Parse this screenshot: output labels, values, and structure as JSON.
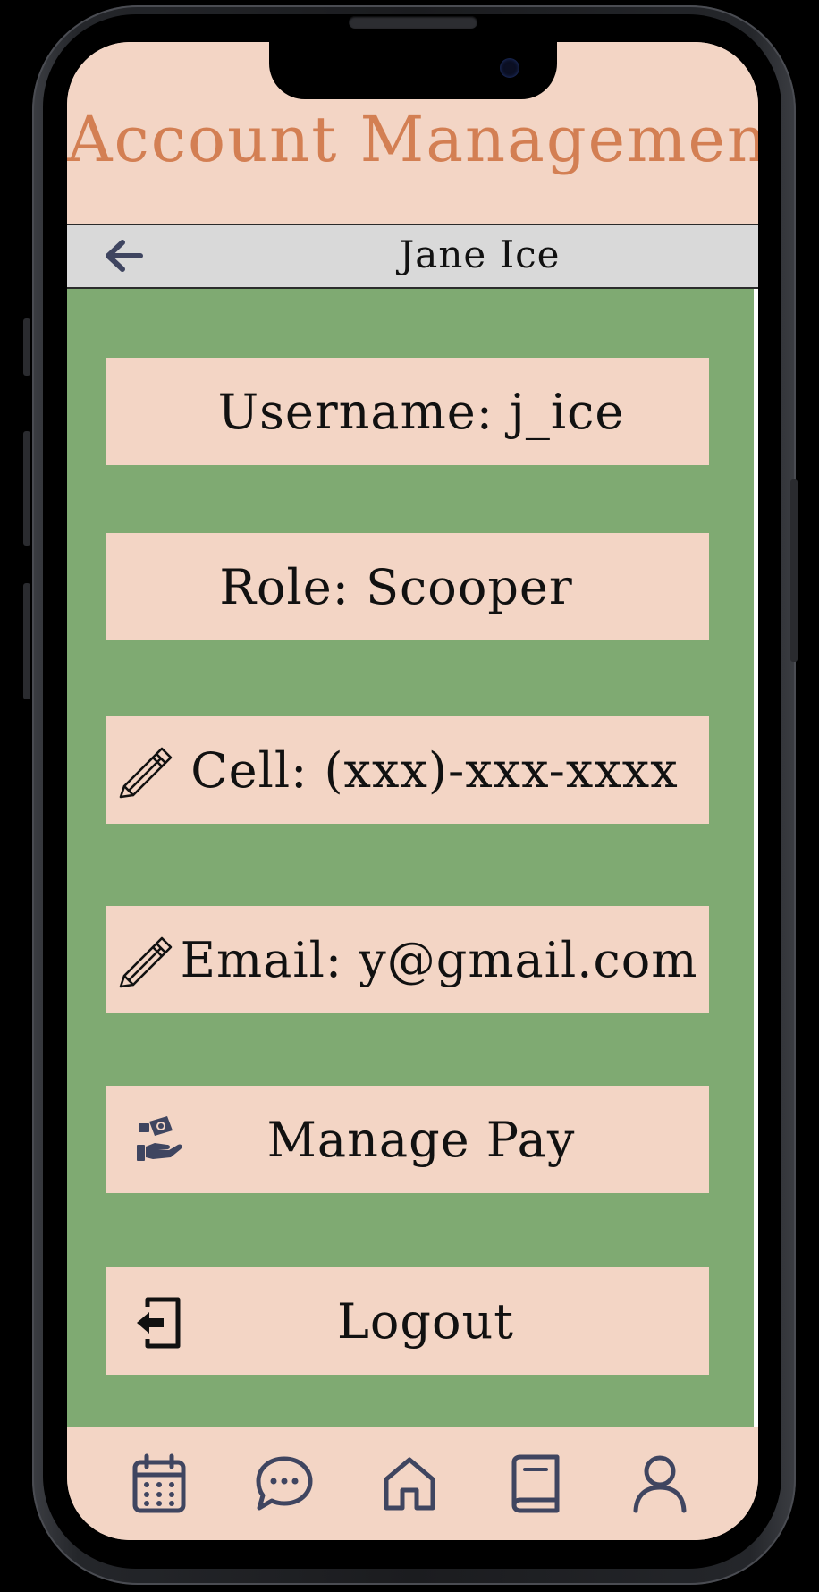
{
  "header": {
    "title": "Account Management"
  },
  "subheader": {
    "user_name": "Jane Ice",
    "back_icon": "arrow-left-icon"
  },
  "account": {
    "username_label": "Username: j_ice",
    "role_label": "Role: Scooper",
    "cell_label": "Cell: (xxx)-xxx-xxxx",
    "email_label": "Email: y@gmail.com",
    "manage_pay_label": "Manage Pay",
    "logout_label": "Logout"
  },
  "icons": {
    "edit": "pencil-icon",
    "pay": "hand-money-icon",
    "logout": "logout-icon"
  },
  "bottom_nav": {
    "items": [
      "calendar-icon",
      "chat-icon",
      "home-icon",
      "book-icon",
      "profile-icon"
    ]
  },
  "colors": {
    "title": "#d37f53",
    "background_peach": "#f3d5c5",
    "content_green": "#7faa72",
    "subheader_gray": "#d9d9d9",
    "nav_icon": "#3f4560"
  }
}
